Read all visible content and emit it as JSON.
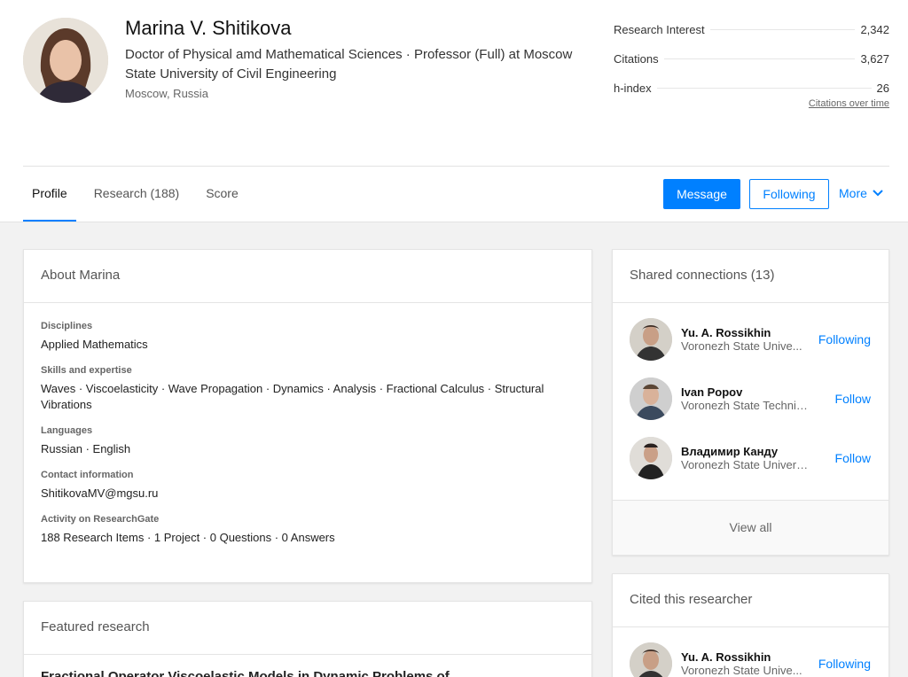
{
  "profile": {
    "name": "Marina V. Shitikova",
    "title": "Doctor of Physical amd Mathematical Sciences · Professor (Full) at Moscow State University of Civil Engineering",
    "location": "Moscow, Russia"
  },
  "stats": [
    {
      "label": "Research Interest",
      "value": "2,342"
    },
    {
      "label": "Citations",
      "value": "3,627"
    },
    {
      "label": "h-index",
      "value": "26"
    }
  ],
  "citations_link": "Citations over time",
  "tabs": [
    {
      "label": "Profile"
    },
    {
      "label": "Research (188)"
    },
    {
      "label": "Score"
    }
  ],
  "actions": {
    "message": "Message",
    "following": "Following",
    "more": "More"
  },
  "about": {
    "heading": "About Marina",
    "disciplines_label": "Disciplines",
    "disciplines": "Applied Mathematics",
    "skills_label": "Skills and expertise",
    "skills": "Waves · Viscoelasticity · Wave Propagation · Dynamics · Analysis · Fractional Calculus · Structural Vibrations",
    "languages_label": "Languages",
    "languages": "Russian · English",
    "contact_label": "Contact information",
    "contact": "ShitikovaMV@mgsu.ru",
    "activity_label": "Activity on ResearchGate",
    "activity": "188 Research Items · 1 Project · 0 Questions · 0 Answers"
  },
  "featured": {
    "heading": "Featured research",
    "first_title": "Fractional Operator Viscoelastic Models in Dynamic Problems of"
  },
  "shared": {
    "heading": "Shared connections (13)",
    "people": [
      {
        "name": "Yu. A. Rossikhin",
        "inst": "Voronezh State Unive...",
        "action": "Following"
      },
      {
        "name": "Ivan Popov",
        "inst": "Voronezh State Technic...",
        "action": "Follow"
      },
      {
        "name": "Владимир Канду",
        "inst": "Voronezh State Universi...",
        "action": "Follow"
      }
    ],
    "view_all": "View all"
  },
  "cited": {
    "heading": "Cited this researcher",
    "people": [
      {
        "name": "Yu. A. Rossikhin",
        "inst": "Voronezh State Unive...",
        "action": "Following"
      }
    ]
  },
  "colors": {
    "accent": "#0080ff"
  }
}
